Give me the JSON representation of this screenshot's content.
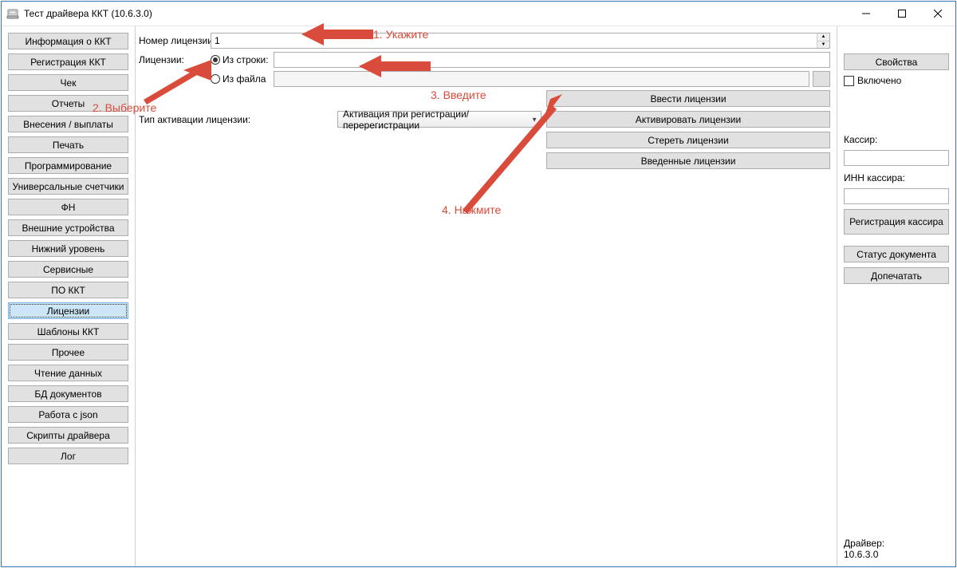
{
  "window": {
    "title": "Тест драйвера ККТ (10.6.3.0)"
  },
  "sidebar": {
    "items": [
      {
        "label": "Информация о ККТ"
      },
      {
        "label": "Регистрация ККТ"
      },
      {
        "label": "Чек"
      },
      {
        "label": "Отчеты"
      },
      {
        "label": "Внесения / выплаты"
      },
      {
        "label": "Печать"
      },
      {
        "label": "Программирование"
      },
      {
        "label": "Универсальные счетчики"
      },
      {
        "label": "ФН"
      },
      {
        "label": "Внешние устройства"
      },
      {
        "label": "Нижний уровень"
      },
      {
        "label": "Сервисные"
      },
      {
        "label": "ПО ККТ"
      },
      {
        "label": "Лицензии",
        "selected": true
      },
      {
        "label": "Шаблоны ККТ"
      },
      {
        "label": "Прочее"
      },
      {
        "label": "Чтение данных"
      },
      {
        "label": "БД документов"
      },
      {
        "label": "Работа с json"
      },
      {
        "label": "Скрипты драйвера"
      },
      {
        "label": "Лог"
      }
    ]
  },
  "main": {
    "license_number_label": "Номер лицензии:",
    "license_number_value": "1",
    "licenses_label": "Лицензии:",
    "radio_string_label": "Из строки:",
    "radio_file_label": "Из файла",
    "string_value": "",
    "file_value": "",
    "activation_label": "Тип активации лицензии:",
    "activation_combo": "Активация при регистрации/перерегистрации",
    "actions": {
      "enter": "Ввести лицензии",
      "activate": "Активировать лицензии",
      "erase": "Стереть лицензии",
      "entered": "Введенные лицензии"
    }
  },
  "right": {
    "properties": "Свойства",
    "enabled_label": "Включено",
    "cashier_label": "Кассир:",
    "inn_label": "ИНН кассира:",
    "reg_cashier": "Регистрация кассира",
    "doc_status": "Статус документа",
    "reprint": "Допечатать",
    "driver_label": "Драйвер:",
    "driver_ver": "10.6.3.0"
  },
  "annotations": {
    "a1": "1. Укажите",
    "a2": "2. Выберите",
    "a3": "3. Введите",
    "a4": "4. Нажмите"
  }
}
